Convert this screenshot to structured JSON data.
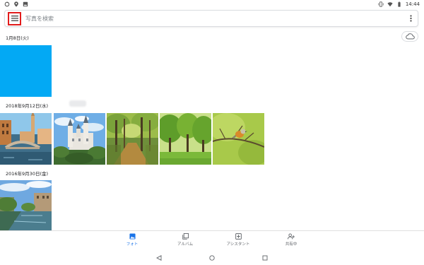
{
  "status_bar": {
    "left_icons": [
      "sync-icon",
      "location-icon",
      "image-icon"
    ],
    "right_icons": [
      "vibrate-icon",
      "wifi-icon",
      "battery-icon"
    ],
    "time": "14:44"
  },
  "search": {
    "placeholder": "写真を検索",
    "menu_icon": "hamburger-menu-icon",
    "overflow_icon": "more-vert-icon"
  },
  "sections": [
    {
      "date": "1月8日(火)",
      "photos": [
        "blue-square"
      ]
    },
    {
      "date": "2018年9月12日(水)",
      "photos": [
        "venice-canal",
        "neuschwanstein-castle",
        "forest-path",
        "green-park-trees",
        "bird-on-branch"
      ]
    },
    {
      "date": "2016年9月30日(金)",
      "photos": [
        "river-city"
      ]
    }
  ],
  "cloud_icon": "cloud-backup-icon",
  "bottom_nav": [
    {
      "label": "フォト",
      "icon": "photo-icon",
      "active": true
    },
    {
      "label": "アルバム",
      "icon": "album-icon",
      "active": false
    },
    {
      "label": "アシスタント",
      "icon": "assistant-icon",
      "active": false
    },
    {
      "label": "共有中",
      "icon": "sharing-icon",
      "active": false
    }
  ],
  "system_nav": [
    "back-icon",
    "home-icon",
    "recents-icon"
  ],
  "colors": {
    "accent": "#1a73e8",
    "highlight_border": "#e21c1c",
    "blue_photo": "#03a9f4"
  }
}
